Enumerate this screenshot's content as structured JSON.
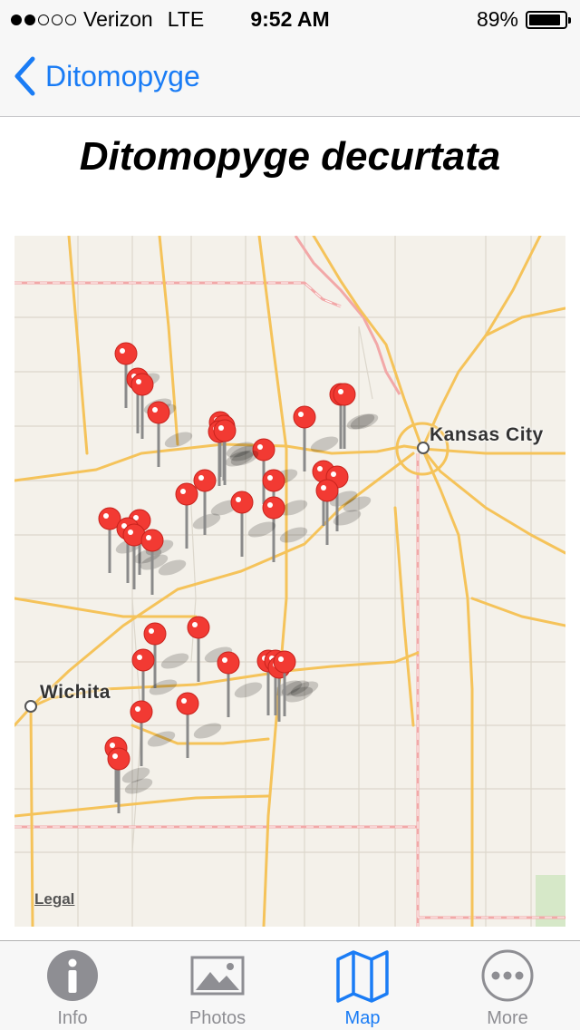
{
  "status_bar": {
    "signal_dots_filled": 2,
    "signal_dots_total": 5,
    "carrier": "Verizon",
    "network": "LTE",
    "time": "9:52 AM",
    "battery_percent_label": "89%",
    "battery_level": 0.89
  },
  "nav": {
    "back_label": "Ditomopyge"
  },
  "page": {
    "title": "Ditomopyge decurtata"
  },
  "map": {
    "cities": [
      {
        "name": "Kansas City"
      },
      {
        "name": "Wichita"
      }
    ],
    "legal_label": "Legal",
    "pin_count": 37,
    "pin_color": "#f23a33",
    "road_color": "#f5c35a",
    "state_border_color": "#f2a8a8",
    "land_color": "#f4f1ea",
    "park_color": "#d6e8c8"
  },
  "tab_bar": {
    "tabs": [
      {
        "label": "Info",
        "icon": "info-icon",
        "active": false
      },
      {
        "label": "Photos",
        "icon": "photo-icon",
        "active": false
      },
      {
        "label": "Map",
        "icon": "map-icon",
        "active": true
      },
      {
        "label": "More",
        "icon": "more-icon",
        "active": false
      }
    ],
    "active_color": "#1a7cf5",
    "inactive_color": "#8e8e93"
  }
}
